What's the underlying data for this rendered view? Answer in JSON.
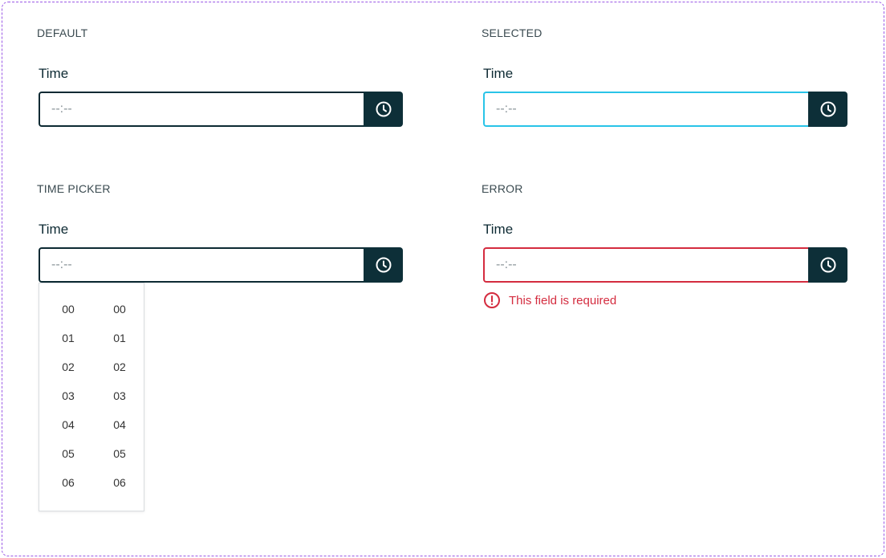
{
  "colors": {
    "dark": "#0d2f38",
    "selected_border": "#29c4e8",
    "error": "#d42c3f",
    "frame_dash": "#9b59e6"
  },
  "sections": {
    "default": {
      "title": "DEFAULT",
      "label": "Time",
      "placeholder": "--:--"
    },
    "selected": {
      "title": "SELECTED",
      "label": "Time",
      "placeholder": "--:--"
    },
    "picker": {
      "title": "TIME PICKER",
      "label": "Time",
      "placeholder": "--:--",
      "hours": [
        "00",
        "01",
        "02",
        "03",
        "04",
        "05",
        "06"
      ],
      "minutes": [
        "00",
        "01",
        "02",
        "03",
        "04",
        "05",
        "06"
      ]
    },
    "error": {
      "title": "ERROR",
      "label": "Time",
      "placeholder": "--:--",
      "message": "This field is required"
    }
  },
  "icons": {
    "clock": "clock-icon",
    "error": "error-alert-icon"
  }
}
